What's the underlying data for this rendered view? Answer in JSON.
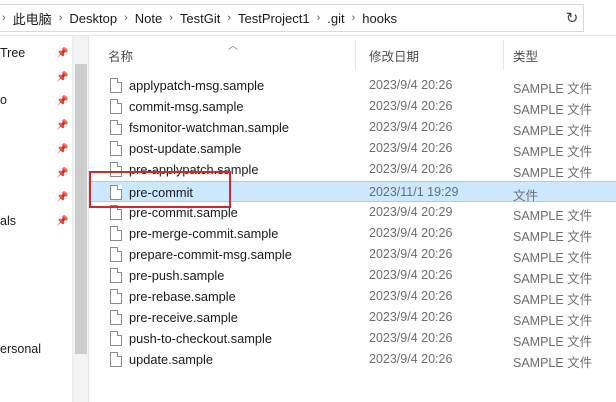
{
  "breadcrumb": {
    "items": [
      "此电脑",
      "Desktop",
      "Note",
      "TestGit",
      "TestProject1",
      ".git",
      "hooks"
    ]
  },
  "nav": {
    "items": [
      "Tree",
      "o",
      "als",
      "ersonal"
    ]
  },
  "columns": {
    "name": "名称",
    "date": "修改日期",
    "type": "类型"
  },
  "files": [
    {
      "name": "applypatch-msg.sample",
      "date": "2023/9/4 20:26",
      "type": "SAMPLE 文件"
    },
    {
      "name": "commit-msg.sample",
      "date": "2023/9/4 20:26",
      "type": "SAMPLE 文件"
    },
    {
      "name": "fsmonitor-watchman.sample",
      "date": "2023/9/4 20:26",
      "type": "SAMPLE 文件"
    },
    {
      "name": "post-update.sample",
      "date": "2023/9/4 20:26",
      "type": "SAMPLE 文件"
    },
    {
      "name": "pre-applypatch.sample",
      "date": "2023/9/4 20:26",
      "type": "SAMPLE 文件"
    },
    {
      "name": "pre-commit",
      "date": "2023/11/1 19:29",
      "type": "文件"
    },
    {
      "name": "pre-commit.sample",
      "date": "2023/9/4 20:29",
      "type": "SAMPLE 文件"
    },
    {
      "name": "pre-merge-commit.sample",
      "date": "2023/9/4 20:26",
      "type": "SAMPLE 文件"
    },
    {
      "name": "prepare-commit-msg.sample",
      "date": "2023/9/4 20:26",
      "type": "SAMPLE 文件"
    },
    {
      "name": "pre-push.sample",
      "date": "2023/9/4 20:26",
      "type": "SAMPLE 文件"
    },
    {
      "name": "pre-rebase.sample",
      "date": "2023/9/4 20:26",
      "type": "SAMPLE 文件"
    },
    {
      "name": "pre-receive.sample",
      "date": "2023/9/4 20:26",
      "type": "SAMPLE 文件"
    },
    {
      "name": "push-to-checkout.sample",
      "date": "2023/9/4 20:26",
      "type": "SAMPLE 文件"
    },
    {
      "name": "update.sample",
      "date": "2023/9/4 20:26",
      "type": "SAMPLE 文件"
    }
  ],
  "selected_file": "pre-commit",
  "colors": {
    "selection_bg": "#cce8ff",
    "selection_border": "#99d1ff",
    "highlight_box": "#d9262a"
  }
}
